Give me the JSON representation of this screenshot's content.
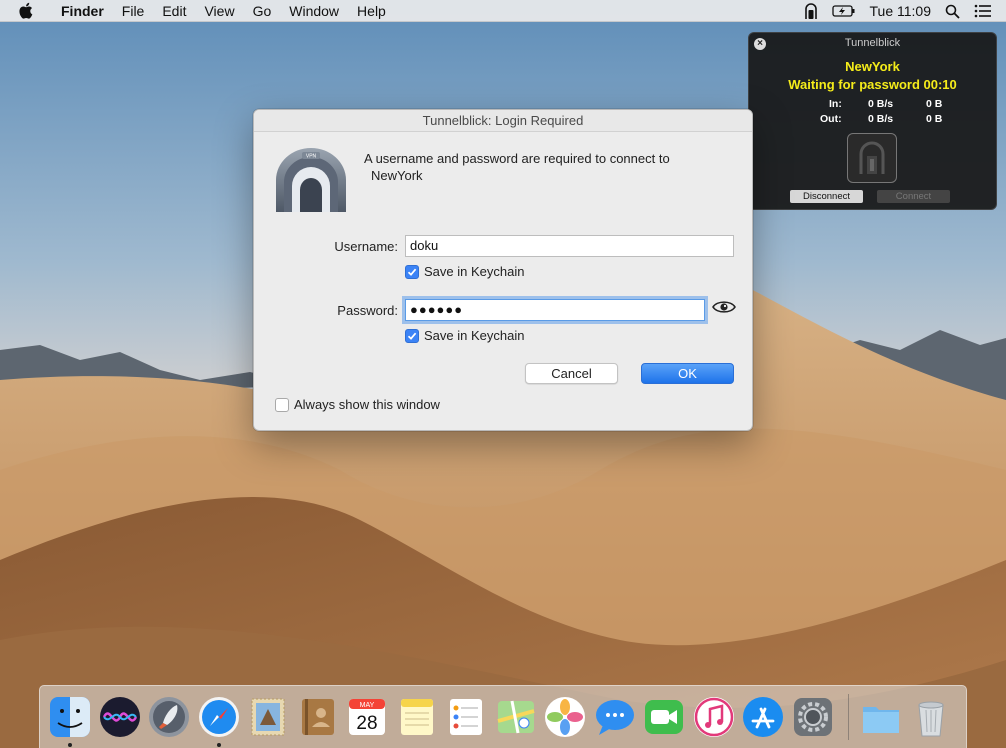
{
  "menubar": {
    "apple_icon": "apple-icon",
    "app_name": "Finder",
    "items": [
      "File",
      "Edit",
      "View",
      "Go",
      "Window",
      "Help"
    ],
    "clock": "Tue 11:09"
  },
  "hud": {
    "title": "Tunnelblick",
    "connection_name": "NewYork",
    "status": "Waiting for password 00:10",
    "in_label": "In:",
    "in_rate": "0 B/s",
    "in_total": "0 B",
    "out_label": "Out:",
    "out_rate": "0 B/s",
    "out_total": "0 B",
    "disconnect_label": "Disconnect",
    "connect_label": "Connect"
  },
  "dialog": {
    "title": "Tunnelblick: Login Required",
    "message": "A username and password are required to connect to",
    "server": "NewYork",
    "username_label": "Username:",
    "username_value": "doku",
    "save_username_label": "Save in Keychain",
    "save_username_checked": true,
    "password_label": "Password:",
    "password_value": "●●●●●●",
    "save_password_label": "Save in Keychain",
    "save_password_checked": true,
    "cancel_label": "Cancel",
    "ok_label": "OK",
    "always_show_label": "Always show this window",
    "always_show_checked": false
  },
  "dock": {
    "items": [
      "Finder",
      "Siri",
      "Launchpad",
      "Safari",
      "Mail",
      "Contacts",
      "Calendar",
      "Notes",
      "Reminders",
      "Maps",
      "Photos",
      "Messages",
      "FaceTime",
      "iTunes",
      "App Store",
      "System Preferences"
    ],
    "calendar_month": "MAY",
    "calendar_day": "28",
    "right_items": [
      "Downloads",
      "Trash"
    ]
  },
  "colors": {
    "accent": "#3b83f6",
    "hud_text": "#f5ec1a"
  }
}
